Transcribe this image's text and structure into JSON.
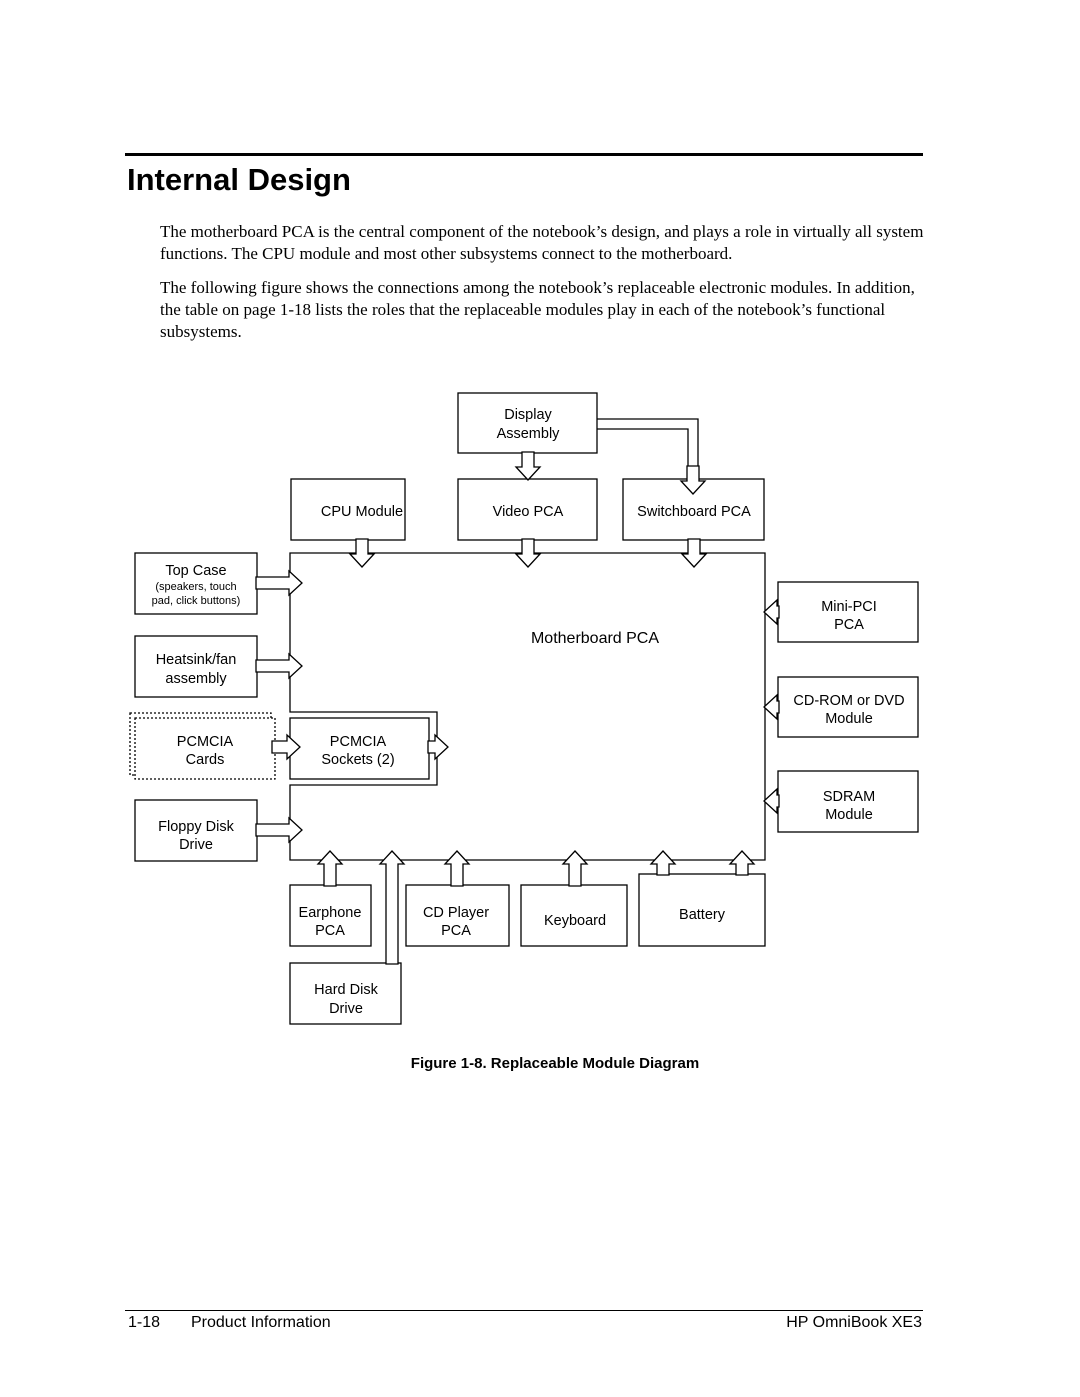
{
  "title": "Internal Design",
  "paragraphs": [
    "The motherboard PCA is the central component of the notebook’s design, and plays a role in virtually all system functions. The CPU module and most other subsystems connect to the motherboard.",
    "The following figure shows the connections among the notebook’s replaceable electronic modules. In addition, the table on page 1-18 lists the roles that the replaceable modules play in each of the notebook’s functional subsystems."
  ],
  "diagram": {
    "display": [
      "Display",
      "Assembly"
    ],
    "cpu": "CPU Module",
    "video": "Video PCA",
    "switchboard": "Switchboard PCA",
    "motherboard": "Motherboard PCA",
    "topcase": [
      "Top Case",
      "(speakers, touch",
      "pad, click buttons)"
    ],
    "heatsink": [
      "Heatsink/fan",
      "assembly"
    ],
    "pcmcia_cards": [
      "PCMCIA",
      "Cards"
    ],
    "pcmcia_sockets": [
      "PCMCIA",
      "Sockets (2)"
    ],
    "floppy": [
      "Floppy Disk",
      "Drive"
    ],
    "minipci": [
      "Mini-PCI",
      "PCA"
    ],
    "cdrom": [
      "CD-ROM or DVD",
      "Module"
    ],
    "sdram": [
      "SDRAM",
      "Module"
    ],
    "earphone": [
      "Earphone",
      "PCA"
    ],
    "cdplayer": [
      "CD Player",
      "PCA"
    ],
    "keyboard": "Keyboard",
    "battery": "Battery",
    "harddisk": [
      "Hard Disk",
      "Drive"
    ]
  },
  "caption": "Figure 1-8. Replaceable Module Diagram",
  "footer": {
    "page": "1-18",
    "section": "Product Information",
    "product": "HP OmniBook XE3"
  }
}
